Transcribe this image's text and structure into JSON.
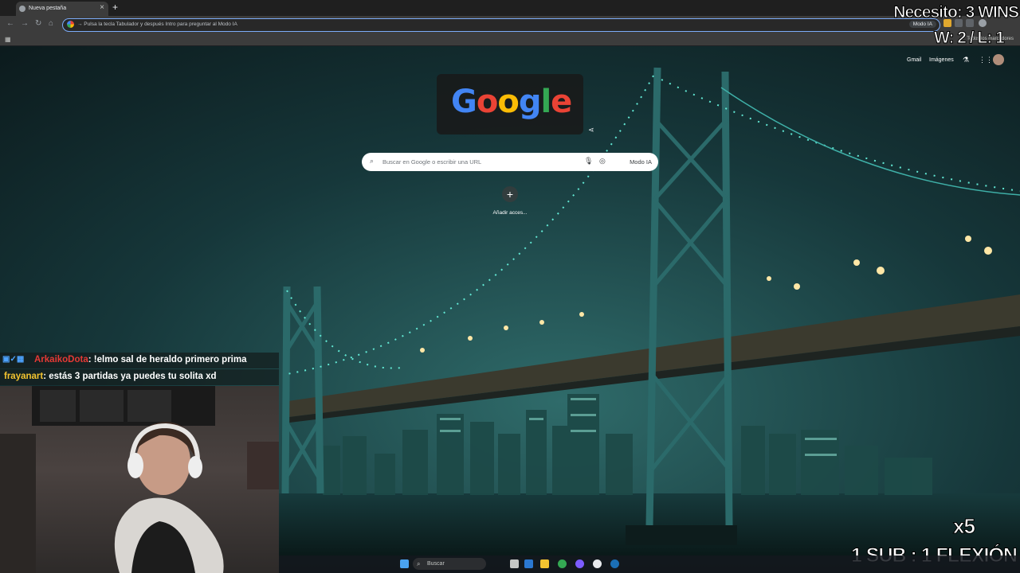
{
  "browser": {
    "tab_title": "Nueva pestaña",
    "tab_close": "×",
    "new_tab": "+",
    "omnibox_text": "→ Pulsa la tecla Tabulador y después Intro para preguntar al Modo IA",
    "omnibox_modo": "Modo IA",
    "all_bookmarks": "Todos los marcadores"
  },
  "ntp": {
    "links": [
      "Gmail",
      "Imágenes"
    ],
    "doodle_letters": [
      "G",
      "o",
      "o",
      "g",
      "l",
      "e"
    ],
    "search_placeholder": "Buscar en Google o escribir una URL",
    "search_modo": "Modo IA",
    "add_shortcut_icon": "+",
    "add_shortcut_label": "Añadir acces..."
  },
  "overlay": {
    "needs": "Necesito: 3 WINS",
    "score": "W: 2 / L: 1",
    "multiplier": "x5",
    "sub_rule": "1 SUB : 1 FLEXIÓN"
  },
  "chat": [
    {
      "user": "ArkaikoDota",
      "message": ": !elmo sal de heraldo primero prima"
    },
    {
      "user": "frayanart",
      "message": ": estás 3 partidas ya puedes tu solita xd"
    }
  ],
  "taskbar": {
    "search_label": "Buscar"
  },
  "colors": {
    "accent": "#7cacf8",
    "chat_name_1": "#e53935",
    "chat_name_2": "#f4c430"
  }
}
